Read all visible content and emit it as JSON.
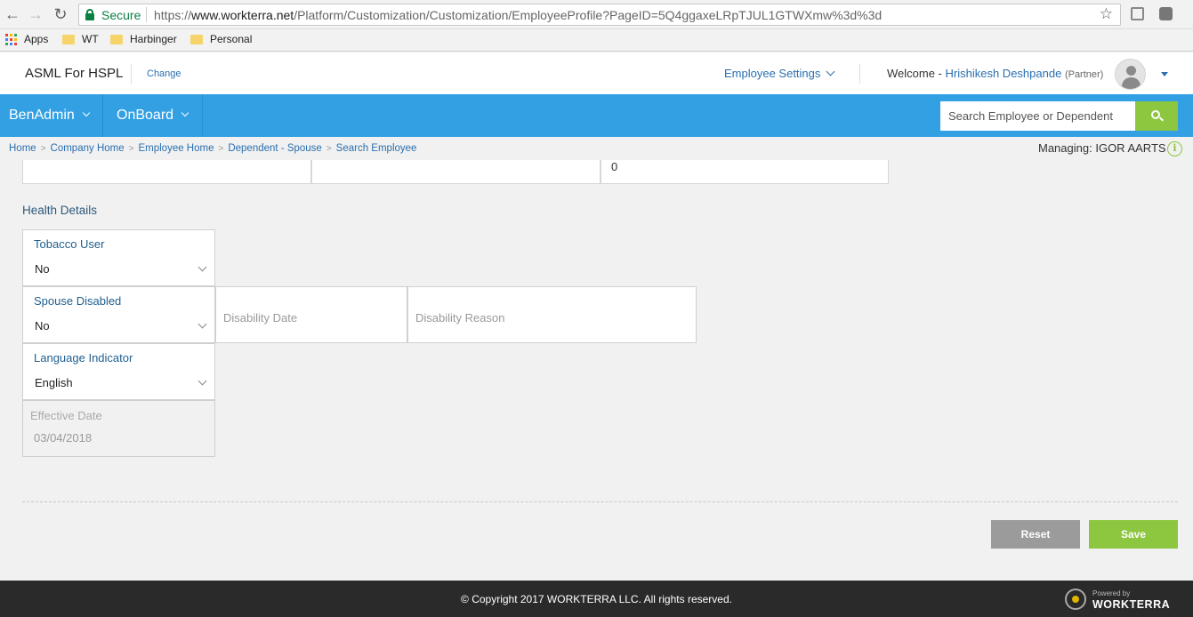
{
  "browser": {
    "secure_label": "Secure",
    "url_prefix": "https://",
    "url_host": "www.workterra.net",
    "url_path": "/Platform/Customization/Customization/EmployeeProfile?PageID=5Q4ggaxeLRpTJUL1GTWXmw%3d%3d",
    "bookmarks": [
      "Apps",
      "WT",
      "Harbinger",
      "Personal"
    ]
  },
  "header": {
    "company": "ASML For HSPL",
    "change_link": "Change",
    "employee_settings": "Employee Settings",
    "welcome": "Welcome -",
    "user_name": "Hrishikesh Deshpande",
    "user_role": "(Partner)"
  },
  "nav": {
    "items": [
      "BenAdmin",
      "OnBoard"
    ],
    "search_placeholder": "Search Employee or Dependent"
  },
  "breadcrumb": [
    "Home",
    "Company Home",
    "Employee Home",
    "Dependent - Spouse",
    "Search Employee"
  ],
  "managing": {
    "label": "Managing:",
    "name": "IGOR AARTS"
  },
  "top_fields": {
    "third_value": "0"
  },
  "health": {
    "section_title": "Health Details",
    "tobacco": {
      "label": "Tobacco User",
      "value": "No"
    },
    "spouse_disabled": {
      "label": "Spouse Disabled",
      "value": "No"
    },
    "disability_date": {
      "placeholder": "Disability Date"
    },
    "disability_reason": {
      "placeholder": "Disability Reason"
    },
    "language": {
      "label": "Language Indicator",
      "value": "English"
    },
    "effective_date": {
      "label": "Effective Date",
      "value": "03/04/2018"
    }
  },
  "actions": {
    "reset": "Reset",
    "save": "Save"
  },
  "footer": {
    "copyright": "© Copyright 2017 WORKTERRA LLC. All rights reserved.",
    "powered_by": "Powered by",
    "brand": "WORKTERRA"
  },
  "colors": {
    "nav_blue": "#33a0e4",
    "accent_green": "#8dc63f",
    "link_blue": "#2a6fb0"
  }
}
